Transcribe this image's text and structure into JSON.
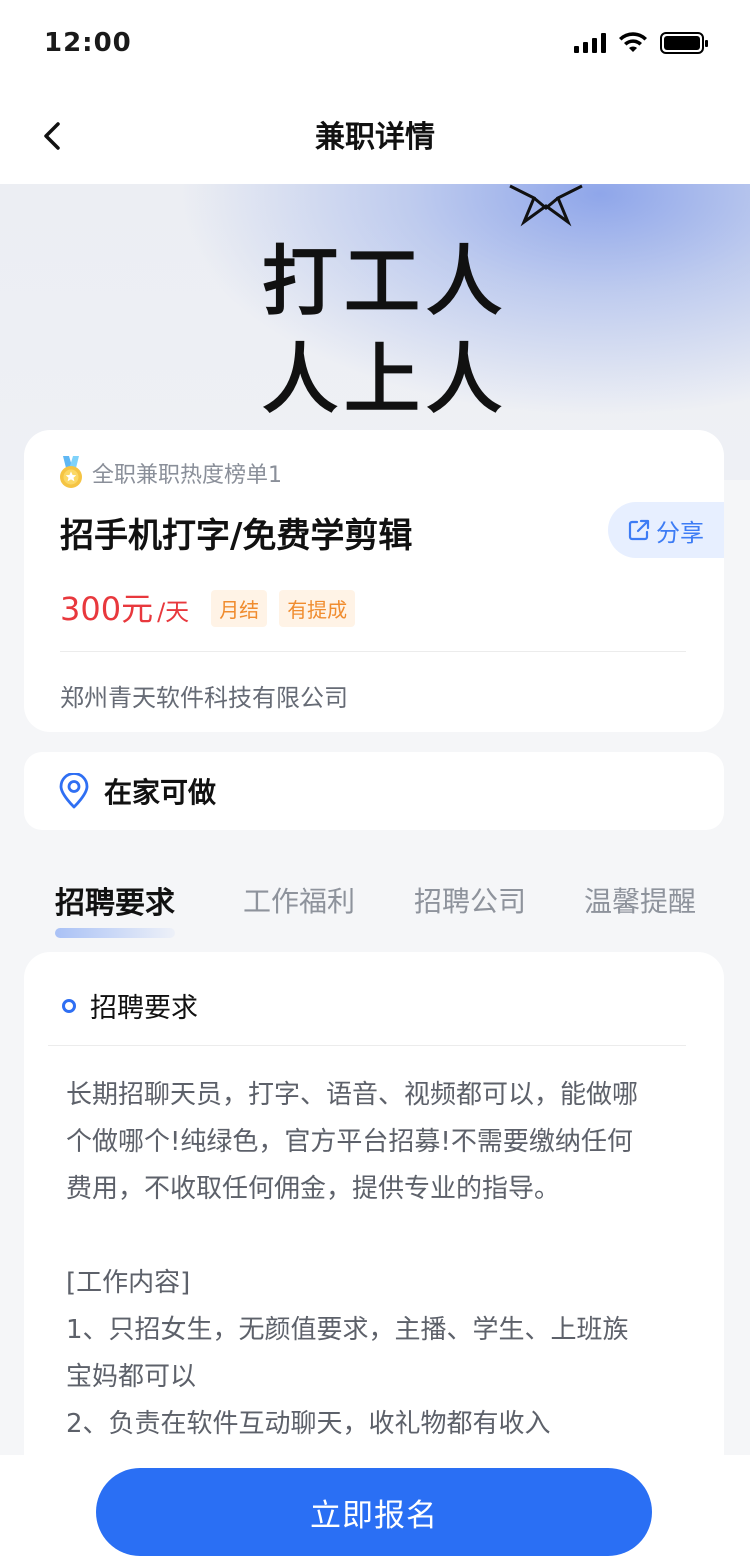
{
  "status_bar": {
    "time": "12:00"
  },
  "nav": {
    "title": "兼职详情",
    "back_icon": "chevron-left-icon"
  },
  "banner": {
    "line1": "打工人",
    "line2": "人上人"
  },
  "job": {
    "rank_label": "全职兼职热度榜单1",
    "title": "招手机打字/免费学剪辑",
    "share_label": "分享",
    "salary_amount": "300元",
    "salary_unit": "/天",
    "tags": [
      "月结",
      "有提成"
    ],
    "company": "郑州青天软件科技有限公司"
  },
  "location": {
    "text": "在家可做"
  },
  "tabs": [
    {
      "label": "招聘要求",
      "active": true
    },
    {
      "label": "工作福利",
      "active": false
    },
    {
      "label": "招聘公司",
      "active": false
    },
    {
      "label": "温馨提醒",
      "active": false
    }
  ],
  "requirements": {
    "header": "招聘要求",
    "lines": [
      "长期招聊天员，打字、语音、视频都可以，能做哪",
      "个做哪个!纯绿色，官方平台招募!不需要缴纳任何",
      "费用，不收取任何佣金，提供专业的指导。",
      "",
      "[工作内容]",
      "1、只招女生，无颜值要求，主播、学生、上班族",
      "宝妈都可以",
      "2、负责在软件互动聊天，收礼物都有收入"
    ]
  },
  "footer": {
    "apply_label": "立即报名"
  },
  "colors": {
    "primary": "#2a6ff4",
    "salary": "#e8383d",
    "tag": "#f08c2f",
    "tag_bg": "#fff3e6"
  }
}
